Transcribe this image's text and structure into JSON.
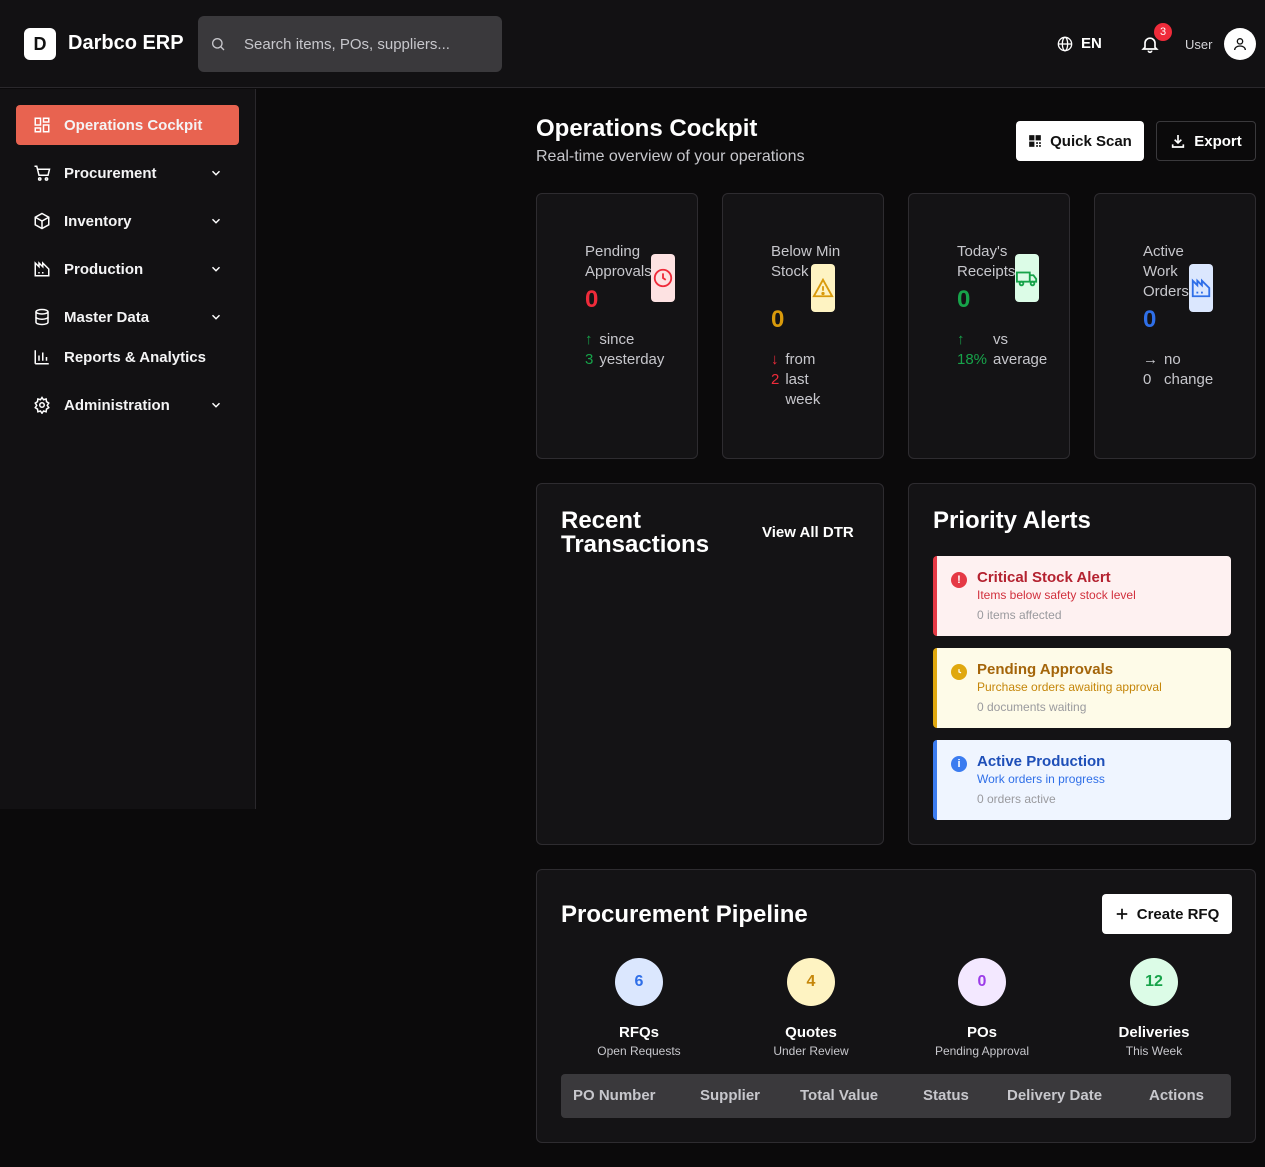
{
  "header": {
    "logo_letter": "D",
    "brand": "Darbco ERP",
    "search_placeholder": "Search items, POs, suppliers...",
    "language": "EN",
    "notification_count": "3",
    "user_label": "User"
  },
  "sidebar": {
    "items": [
      {
        "label": "Operations Cockpit",
        "icon": "dashboard-icon"
      },
      {
        "label": "Procurement",
        "icon": "cart-icon"
      },
      {
        "label": "Inventory",
        "icon": "box-icon"
      },
      {
        "label": "Production",
        "icon": "factory-icon"
      },
      {
        "label": "Master Data",
        "icon": "database-icon"
      },
      {
        "label": "Reports & Analytics",
        "icon": "bar-chart-icon"
      },
      {
        "label": "Administration",
        "icon": "gear-icon"
      }
    ]
  },
  "page": {
    "title": "Operations Cockpit",
    "subtitle": "Real-time overview of your operations",
    "quick_scan": "Quick Scan",
    "export": "Export"
  },
  "kpis": [
    {
      "label": "Pending Approvals",
      "value": "0",
      "trend_arrow": "↑",
      "trend_value": "3",
      "trend_text_1": "since",
      "trend_text_2": "yesterday",
      "color": "#ef2b3a",
      "icon": "clock-icon"
    },
    {
      "label": "Below Min Stock",
      "value": "0",
      "trend_arrow": "↓",
      "trend_value": "2",
      "trend_text_1": "from",
      "trend_text_2": "last",
      "trend_text_3": "week",
      "color": "#d99a0b",
      "icon": "warning-icon"
    },
    {
      "label": "Today's Receipts",
      "value": "0",
      "trend_arrow": "↑",
      "trend_value": "18%",
      "trend_text_1": "vs",
      "trend_text_2": "average",
      "color": "#17a34a",
      "icon": "truck-icon"
    },
    {
      "label": "Active Work Orders",
      "value": "0",
      "trend_arrow": "→",
      "trend_value": "0",
      "trend_text_1": "no",
      "trend_text_2": "change",
      "color": "#2f6fe8",
      "icon": "factory-icon"
    }
  ],
  "recent": {
    "title": "Recent Transactions",
    "link": "View All DTR"
  },
  "alerts": {
    "title": "Priority Alerts",
    "items": [
      {
        "title": "Critical Stock Alert",
        "desc": "Items below safety stock level",
        "meta": "0 items affected"
      },
      {
        "title": "Pending Approvals",
        "desc": "Purchase orders awaiting approval",
        "meta": "0 documents waiting"
      },
      {
        "title": "Active Production",
        "desc": "Work orders in progress",
        "meta": "0 orders active"
      }
    ]
  },
  "pipeline": {
    "title": "Procurement Pipeline",
    "create_button": "Create RFQ",
    "stages": [
      {
        "count": "6",
        "label": "RFQs",
        "sub": "Open Requests"
      },
      {
        "count": "4",
        "label": "Quotes",
        "sub": "Under Review"
      },
      {
        "count": "0",
        "label": "POs",
        "sub": "Pending Approval"
      },
      {
        "count": "12",
        "label": "Deliveries",
        "sub": "This Week"
      }
    ],
    "columns": [
      "PO Number",
      "Supplier",
      "Total Value",
      "Status",
      "Delivery Date",
      "Actions"
    ]
  }
}
